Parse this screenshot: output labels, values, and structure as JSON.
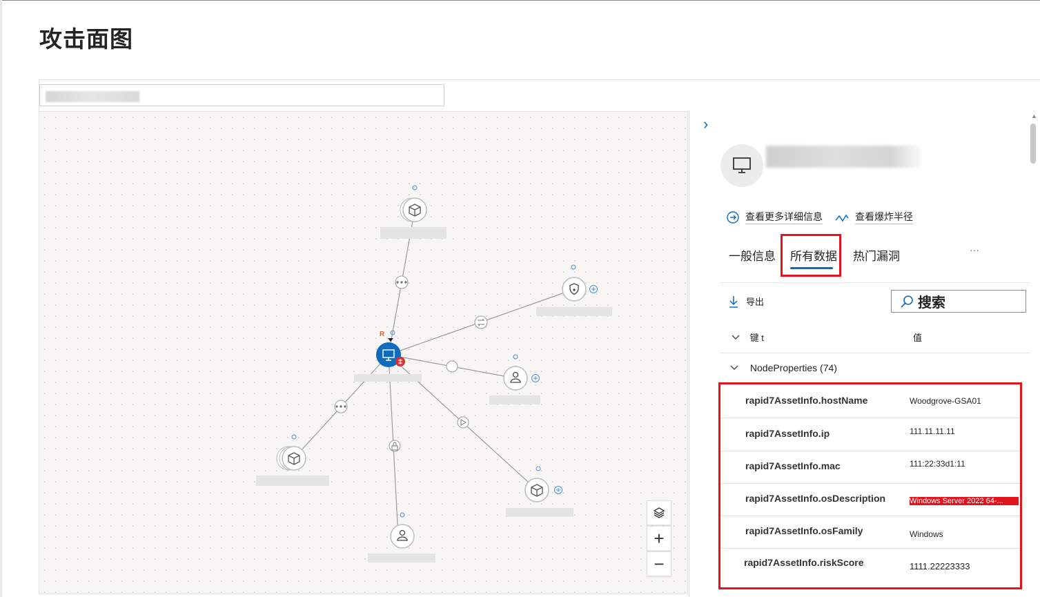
{
  "page": {
    "title": "攻击面图"
  },
  "graph_controls": {
    "zoom_in": "+",
    "zoom_out": "−"
  },
  "panel": {
    "collapse_glyph": "›",
    "actions": {
      "view_details": "查看更多详细信息",
      "view_blast": "查看爆炸半径"
    },
    "tabs": [
      {
        "label": "一般信息",
        "selected": false
      },
      {
        "label": "所有数据",
        "selected": true
      },
      {
        "label": "热门漏洞",
        "selected": false
      }
    ],
    "more_tabs": "···",
    "export_label": "导出",
    "search_label": "搜索",
    "columns": {
      "key": "键 t",
      "value": "值"
    },
    "group_label": "NodeProperties (74)",
    "properties": [
      {
        "key": "rapid7AssetInfo.hostName",
        "value": "Woodgrove-GSA01"
      },
      {
        "key": "rapid7AssetInfo.ip",
        "value": "111.11.11.11"
      },
      {
        "key": "rapid7AssetInfo.mac",
        "value": "111:22:33d1:11"
      },
      {
        "key": "rapid7AssetInfo.osDescription",
        "value": "Windows Server 2022 64-..."
      },
      {
        "key": "rapid7AssetInfo.osFamily",
        "value": "Windows"
      },
      {
        "key": "rapid7AssetInfo.riskScore",
        "value": "1111.22223333"
      }
    ]
  },
  "colors": {
    "accent": "#0f6cbd",
    "highlight": "#e3141e",
    "central_node": "#0f6cbd",
    "vulnerability": "#d13438"
  }
}
